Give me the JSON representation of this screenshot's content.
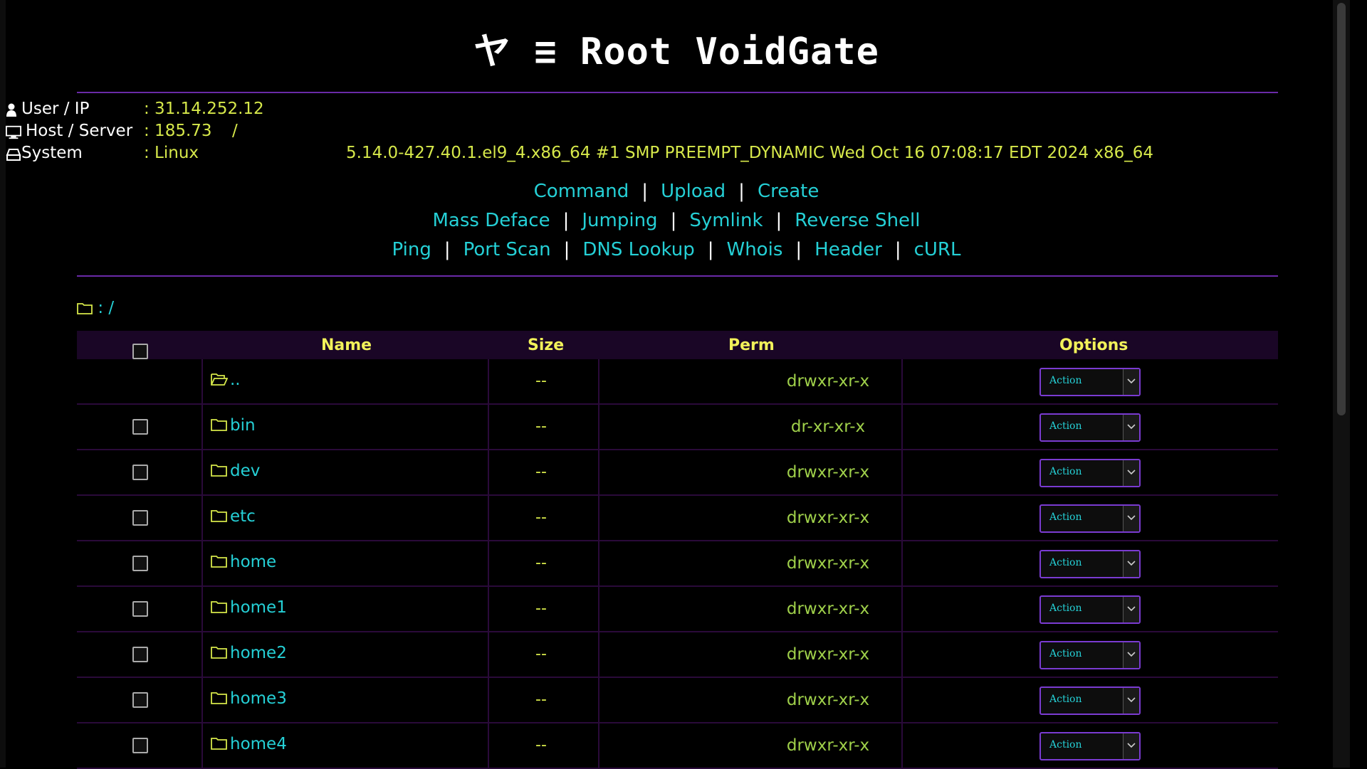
{
  "header": {
    "title": "ヤ ≡ Root VoidGate"
  },
  "info": {
    "user_ip_label": "User / IP",
    "user_ip_value": ": 31.14.252.12",
    "host_label": "Host / Server",
    "host_value": ": 185.73",
    "host_sep": "/",
    "system_label": "System",
    "system_value": ": Linux",
    "uname": "5.14.0-427.40.1.el9_4.x86_64 #1 SMP PREEMPT_DYNAMIC Wed Oct 16 07:08:17 EDT 2024 x86_64"
  },
  "nav": {
    "row1": [
      "Command",
      "Upload",
      "Create"
    ],
    "row2": [
      "Mass Deface",
      "Jumping",
      "Symlink",
      "Reverse Shell"
    ],
    "row3": [
      "Ping",
      "Port Scan",
      "DNS Lookup",
      "Whois",
      "Header",
      "cURL"
    ],
    "separator": "|"
  },
  "path": {
    "text": ": /"
  },
  "table": {
    "headers": {
      "name": "Name",
      "size": "Size",
      "perm": "Perm",
      "options": "Options"
    },
    "action_label": "Action",
    "rows": [
      {
        "name": "..",
        "size": "--",
        "perm": "drwxr-xr-x",
        "parent": true
      },
      {
        "name": "bin",
        "size": "--",
        "perm": "dr-xr-xr-x"
      },
      {
        "name": "dev",
        "size": "--",
        "perm": "drwxr-xr-x"
      },
      {
        "name": "etc",
        "size": "--",
        "perm": "drwxr-xr-x"
      },
      {
        "name": "home",
        "size": "--",
        "perm": "drwxr-xr-x"
      },
      {
        "name": "home1",
        "size": "--",
        "perm": "drwxr-xr-x"
      },
      {
        "name": "home2",
        "size": "--",
        "perm": "drwxr-xr-x"
      },
      {
        "name": "home3",
        "size": "--",
        "perm": "drwxr-xr-x"
      },
      {
        "name": "home4",
        "size": "--",
        "perm": "drwxr-xr-x"
      }
    ]
  },
  "colors": {
    "accent": "#25d0d6",
    "value": "#d6e84a",
    "border": "#6a2aa8",
    "header_text": "#f2f25a"
  }
}
